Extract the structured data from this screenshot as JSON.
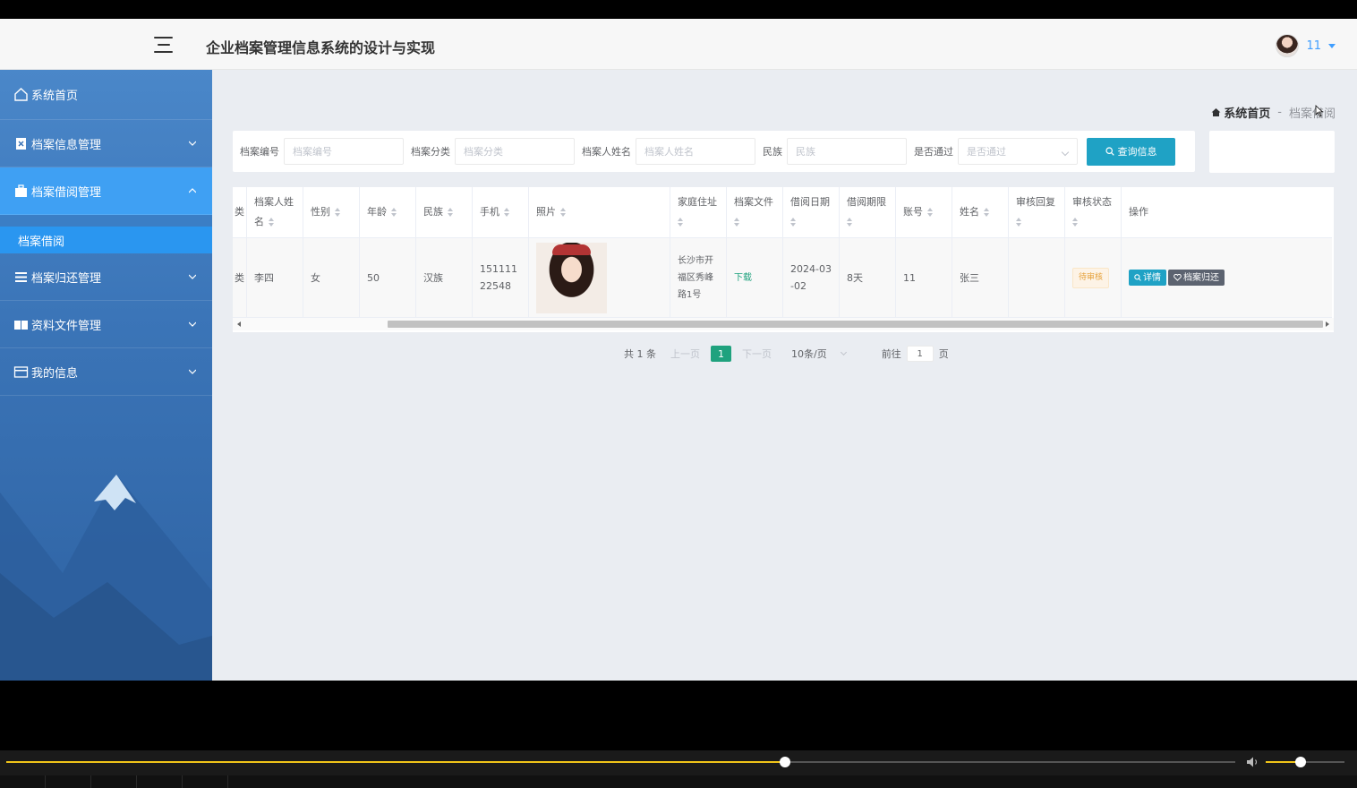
{
  "header": {
    "title": "企业档案管理信息系统的设计与实现",
    "user_name": "11"
  },
  "sidebar": {
    "items": [
      {
        "label": "系统首页",
        "icon": "home-icon"
      },
      {
        "label": "档案信息管理",
        "icon": "archive-icon"
      },
      {
        "label": "档案借阅管理",
        "icon": "briefcase-icon",
        "active": true
      },
      {
        "label": "档案归还管理",
        "icon": "list-icon"
      },
      {
        "label": "资料文件管理",
        "icon": "folder-icon"
      },
      {
        "label": "我的信息",
        "icon": "card-icon"
      }
    ],
    "submenu": {
      "label": "档案借阅"
    }
  },
  "breadcrumb": {
    "home": "系统首页",
    "separator": "-",
    "current": "档案借阅"
  },
  "search": {
    "fields": [
      {
        "label": "档案编号",
        "placeholder": "档案编号"
      },
      {
        "label": "档案分类",
        "placeholder": "档案分类"
      },
      {
        "label": "档案人姓名",
        "placeholder": "档案人姓名"
      },
      {
        "label": "民族",
        "placeholder": "民族"
      },
      {
        "label": "是否通过",
        "placeholder": "是否通过"
      }
    ],
    "button": "查询信息"
  },
  "table": {
    "columns": [
      "类",
      "档案人姓名",
      "性别",
      "年龄",
      "民族",
      "手机",
      "照片",
      "家庭住址",
      "档案文件",
      "借阅日期",
      "借阅期限",
      "账号",
      "姓名",
      "审核回复",
      "审核状态",
      "操作"
    ],
    "rows": [
      {
        "cut": "类",
        "name": "李四",
        "gender": "女",
        "age": "50",
        "ethnicity": "汉族",
        "phone": "15111122548",
        "address": "长沙市开福区秀峰路1号",
        "file": "下载",
        "date": "2024-03-02",
        "period": "8天",
        "account": "11",
        "realname": "张三",
        "reply": "",
        "status": "待审核",
        "actions": {
          "detail": "详情",
          "return": "档案归还"
        }
      }
    ]
  },
  "pagination": {
    "total": "共 1 条",
    "prev": "上一页",
    "current": "1",
    "next": "下一页",
    "page_size": "10条/页",
    "goto_prefix": "前往",
    "goto_value": "1",
    "goto_suffix": "页"
  },
  "player": {
    "progress": 0.634,
    "volume": 0.44
  },
  "colors": {
    "accent": "#1fa2c5",
    "sidebar_active": "#3fa0f3",
    "page_active": "#1fa27e",
    "progress": "#f0c419"
  }
}
